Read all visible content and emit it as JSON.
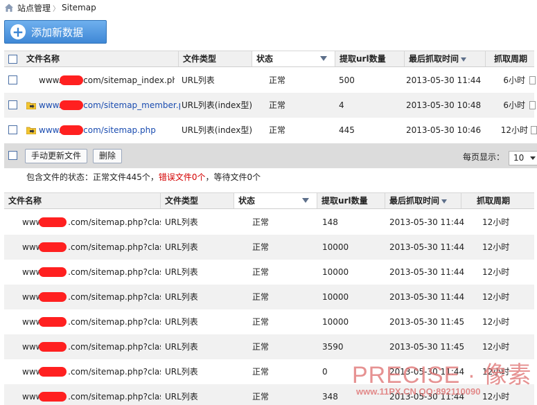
{
  "breadcrumb": {
    "root": "站点管理",
    "current": "Sitemap"
  },
  "add_button": {
    "label": "添加新数据"
  },
  "top_table": {
    "headers": {
      "name": "文件名称",
      "type": "文件类型",
      "status": "状态",
      "count": "提取url数量",
      "time": "最后抓取时间",
      "period": "抓取周期"
    },
    "rows": [
      {
        "prefix": "www.",
        "suffix": "com/sitemap_index.php",
        "type": "URL列表",
        "status": "正常",
        "count": "500",
        "time": "2013-05-30 11:44",
        "period": "6小时"
      },
      {
        "prefix": "www.",
        "suffix": "com/sitemap_member.ph",
        "type": "URL列表(index型)",
        "status": "正常",
        "count": "4",
        "time": "2013-05-30 10:48",
        "period": "6小时"
      },
      {
        "prefix": "www.",
        "suffix": "com/sitemap.php",
        "type": "URL列表(index型)",
        "status": "正常",
        "count": "445",
        "time": "2013-05-30 10:46",
        "period": "12小时"
      }
    ]
  },
  "toolbar": {
    "refresh_label": "手动更新文件",
    "delete_label": "删除",
    "per_page_label": "每页显示：",
    "per_page_value": "10"
  },
  "summary": {
    "prefix": "包含文件的状态：正常文件445个，",
    "error": "错误文件0个",
    "suffix": "，等待文件0个"
  },
  "sub_table": {
    "headers": {
      "name": "文件名称",
      "type": "文件类型",
      "status": "状态",
      "count": "提取url数量",
      "time": "最后抓取时间",
      "period": "抓取周期"
    },
    "rows": [
      {
        "prefix": "www.",
        "suffix": ".com/sitemap.php?classi",
        "type": "URL列表",
        "status": "正常",
        "count": "148",
        "time": "2013-05-30 11:44",
        "period": "12小时"
      },
      {
        "prefix": "www.",
        "suffix": ".com/sitemap.php?classi",
        "type": "URL列表",
        "status": "正常",
        "count": "10000",
        "time": "2013-05-30 11:44",
        "period": "12小时"
      },
      {
        "prefix": "www.",
        "suffix": ".com/sitemap.php?classi",
        "type": "URL列表",
        "status": "正常",
        "count": "10000",
        "time": "2013-05-30 11:44",
        "period": "12小时"
      },
      {
        "prefix": "www.",
        "suffix": ".com/sitemap.php?classi",
        "type": "URL列表",
        "status": "正常",
        "count": "10000",
        "time": "2013-05-30 11:44",
        "period": "12小时"
      },
      {
        "prefix": "www.",
        "suffix": ".com/sitemap.php?classi",
        "type": "URL列表",
        "status": "正常",
        "count": "10000",
        "time": "2013-05-30 11:45",
        "period": "12小时"
      },
      {
        "prefix": "www.",
        "suffix": ".com/sitemap.php?classi",
        "type": "URL列表",
        "status": "正常",
        "count": "3590",
        "time": "2013-05-30 11:45",
        "period": "12小时"
      },
      {
        "prefix": "www.",
        "suffix": ".com/sitemap.php?classi",
        "type": "URL列表",
        "status": "正常",
        "count": "0",
        "time": "2013-05-30 11:44",
        "period": "12小时"
      },
      {
        "prefix": "www.",
        "suffix": ".com/sitemap.php?classi",
        "type": "URL列表",
        "status": "正常",
        "count": "348",
        "time": "2013-05-30 11:44",
        "period": "12小时"
      }
    ]
  },
  "watermark": {
    "title": "PRECISE · 像素",
    "subtitle": "www.11PX.CN QQ:892110090"
  },
  "colors": {
    "link": "#1a4cb0",
    "error": "#d40000",
    "button": "#3f88d6",
    "redaction": "#ff2020"
  }
}
